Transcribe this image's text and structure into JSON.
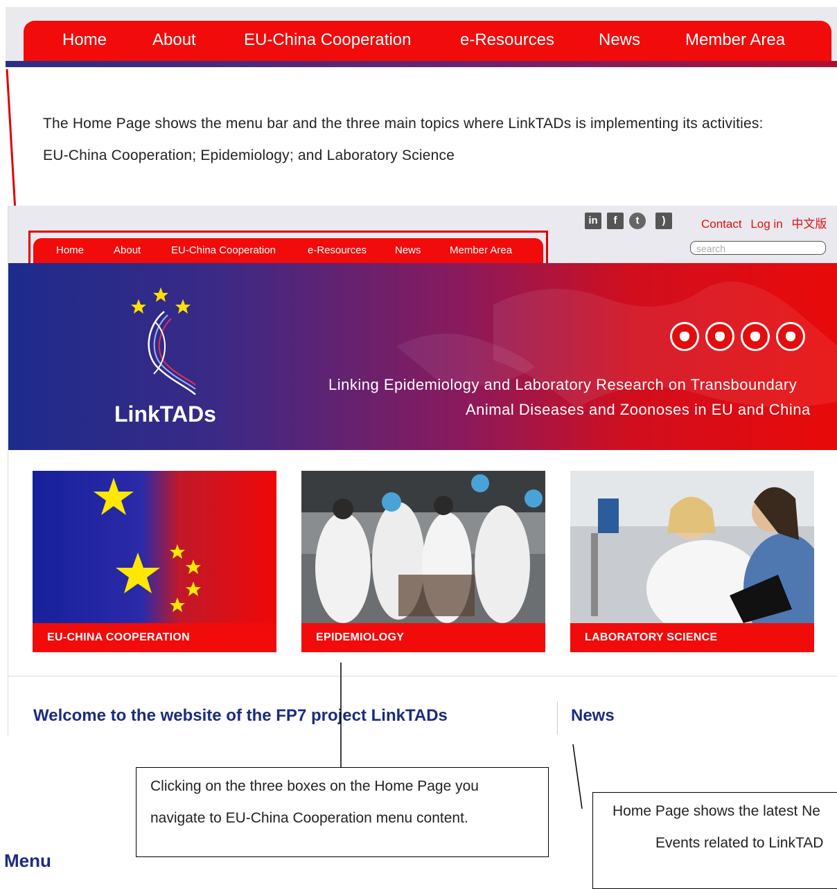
{
  "menu": {
    "items": [
      "Home",
      "About",
      "EU-China Cooperation",
      "e-Resources",
      "News",
      "Member Area"
    ]
  },
  "description": {
    "line1": "The Home Page shows the menu bar and the three main topics where LinkTADs is implementing its activities:",
    "line2": "EU-China Cooperation; Epidemiology; and Laboratory Science"
  },
  "site": {
    "social_icons": [
      "linkedin-icon",
      "facebook-icon",
      "twitter-icon",
      "rss-icon"
    ],
    "top_links": {
      "contact": "Contact",
      "login": "Log in",
      "chinese": "中文版"
    },
    "search_placeholder": "search",
    "banner": {
      "logo": "LinkTADs",
      "tagline_line1": "Linking Epidemiology and Laboratory Research on Transboundary",
      "tagline_line2": "Animal Diseases and Zoonoses in EU and China",
      "animal_icons": [
        "cow-icon",
        "chicken-icon",
        "pig-icon",
        "sheep-icon"
      ]
    },
    "tiles": [
      {
        "label": "EU-CHINA COOPERATION"
      },
      {
        "label": "EPIDEMIOLOGY"
      },
      {
        "label": "LABORATORY SCIENCE"
      }
    ],
    "welcome": "Welcome to the website of the FP7 project LinkTADs",
    "news_heading": "News"
  },
  "callouts": {
    "boxes_line1": "Clicking on the three boxes on the Home Page you",
    "boxes_line2": "navigate to EU-China Cooperation menu content.",
    "news_line1": "Home Page shows the latest Ne",
    "news_line2": "Events related to LinkTAD"
  },
  "section_heading": "Menu",
  "colors": {
    "menu_red": "#f20b0b",
    "heading_blue": "#1a2c7d",
    "highlight_red": "#e00000"
  }
}
